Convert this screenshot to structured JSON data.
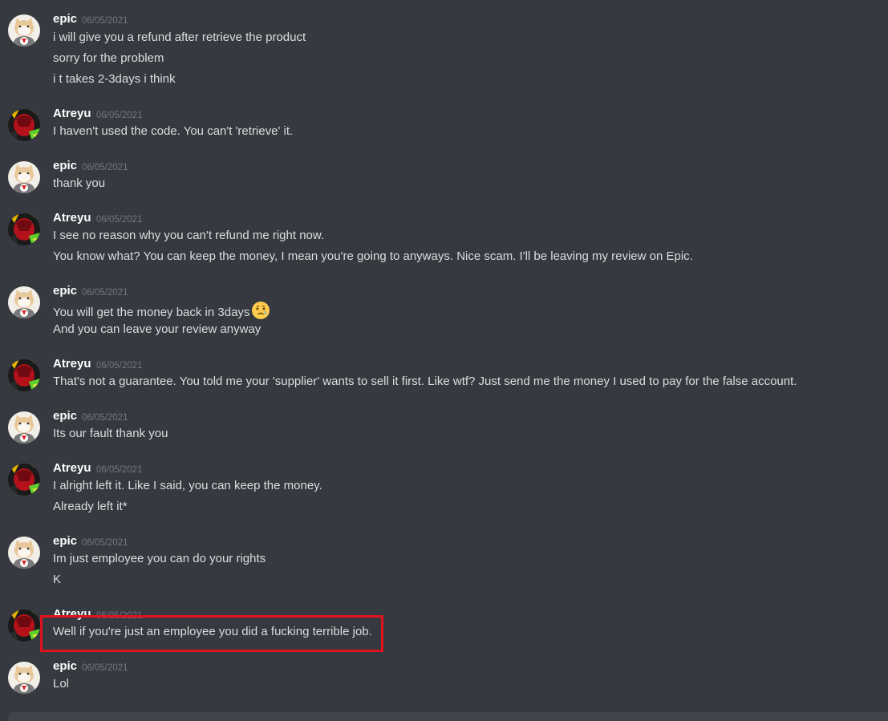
{
  "colors": {
    "background": "#36393f",
    "username": "#ffffff",
    "message_text": "#dcddde",
    "timestamp": "#72767d",
    "highlight": "#e0121d"
  },
  "messages": [
    {
      "author": "epic",
      "timestamp": "06/05/2021",
      "avatar": "epic-avatar-icon",
      "lines": [
        "i will give you a refund after retrieve the product",
        "sorry for the problem",
        "i t takes 2-3days i think"
      ]
    },
    {
      "author": "Atreyu",
      "timestamp": "06/05/2021",
      "avatar": "atreyu-avatar-icon",
      "lines": [
        "I haven't used the code. You can't 'retrieve' it."
      ]
    },
    {
      "author": "epic",
      "timestamp": "06/05/2021",
      "avatar": "epic-avatar-icon",
      "lines": [
        "thank you"
      ]
    },
    {
      "author": "Atreyu",
      "timestamp": "06/05/2021",
      "avatar": "atreyu-avatar-icon",
      "lines": [
        "I see no reason why you can't refund me right now.",
        "You know what? You can keep the money, I mean you're going to anyways. Nice scam. I'll be leaving my review on Epic."
      ]
    },
    {
      "author": "epic",
      "timestamp": "06/05/2021",
      "avatar": "epic-avatar-icon",
      "lines": [
        "You will get the money back in 3days",
        "And you can leave your review anyway"
      ],
      "emoji": "crying-face-emoji"
    },
    {
      "author": "Atreyu",
      "timestamp": "06/05/2021",
      "avatar": "atreyu-avatar-icon",
      "lines": [
        "That's not a guarantee. You told me your 'supplier' wants to sell it first. Like wtf? Just send me the money I used to pay for the false account."
      ]
    },
    {
      "author": "epic",
      "timestamp": "06/05/2021",
      "avatar": "epic-avatar-icon",
      "lines": [
        "Its our fault thank you"
      ]
    },
    {
      "author": "Atreyu",
      "timestamp": "06/05/2021",
      "avatar": "atreyu-avatar-icon",
      "lines": [
        "I alright left it. Like I said, you can keep the money.",
        "Already left it*"
      ]
    },
    {
      "author": "epic",
      "timestamp": "06/05/2021",
      "avatar": "epic-avatar-icon",
      "lines": [
        "Im just employee you can do your rights",
        "K"
      ]
    },
    {
      "author": "Atreyu",
      "timestamp": "06/05/2021",
      "avatar": "atreyu-avatar-icon",
      "lines": [
        "Well if you're just an employee you did a fucking terrible job."
      ],
      "highlighted": true
    },
    {
      "author": "epic",
      "timestamp": "06/05/2021",
      "avatar": "epic-avatar-icon",
      "lines": [
        "Lol"
      ]
    }
  ]
}
